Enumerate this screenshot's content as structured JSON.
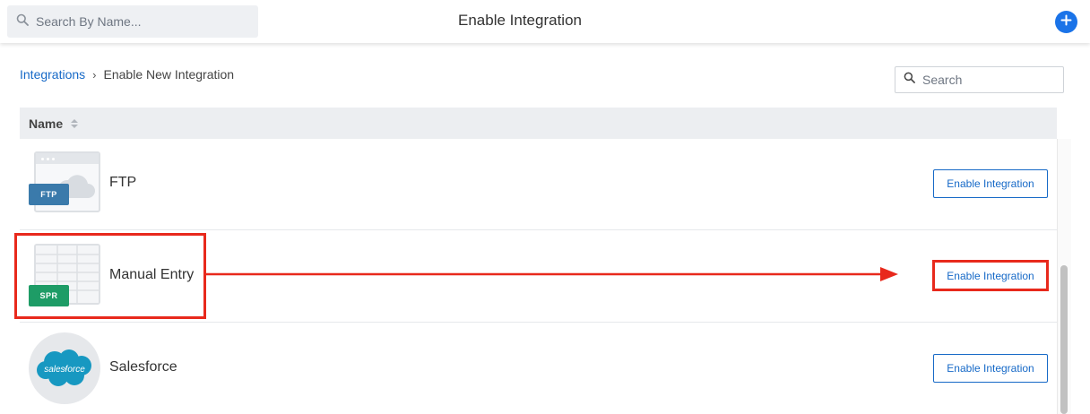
{
  "header": {
    "search_placeholder": "Search By Name...",
    "title": "Enable Integration"
  },
  "breadcrumb": {
    "parent": "Integrations",
    "separator": "›",
    "current": "Enable New Integration"
  },
  "list_search": {
    "placeholder": "Search"
  },
  "table": {
    "column_name": "Name",
    "rows": [
      {
        "name": "FTP",
        "badge": "FTP",
        "button": "Enable Integration"
      },
      {
        "name": "Manual Entry",
        "badge": "SPR",
        "button": "Enable Integration"
      },
      {
        "name": "Salesforce",
        "logo_text": "salesforce",
        "button": "Enable Integration"
      }
    ]
  },
  "colors": {
    "accent": "#1669c7",
    "highlight": "#e8291c",
    "ftp_badge": "#3a7aab",
    "spr_badge": "#1e9c66",
    "salesforce": "#1798c1"
  }
}
